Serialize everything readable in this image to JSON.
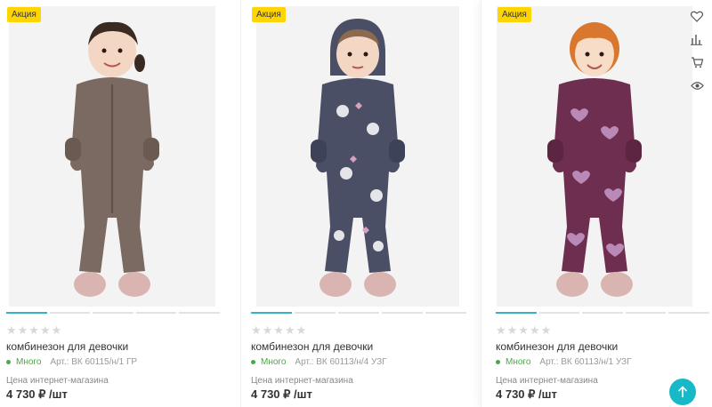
{
  "products": [
    {
      "badge": "Акция",
      "rating_stars": "★★★★★",
      "name": "комбинезон для девочки",
      "stock": "Много",
      "sku": "Арт.: ВК 60115/н/1 ГР",
      "price_label": "Цена интернет-магазина",
      "price": "4 730 ₽ /шт",
      "suit_color": "#7a6a61",
      "pattern": "dots"
    },
    {
      "badge": "Акция",
      "rating_stars": "★★★★★",
      "name": "комбинезон для девочки",
      "stock": "Много",
      "sku": "Арт.: ВК 60113/н/4 УЗГ",
      "price_label": "Цена интернет-магазина",
      "price": "4 730 ₽ /шт",
      "suit_color": "#4b4f66",
      "pattern": "unicorns"
    },
    {
      "badge": "Акция",
      "rating_stars": "★★★★★",
      "name": "комбинезон для девочки",
      "stock": "Много",
      "sku": "Арт.: ВК 60113/н/1 УЗГ",
      "price_label": "Цена интернет-магазина",
      "price": "4 730 ₽ /шт",
      "suit_color": "#6e2e4f",
      "pattern": "hearts"
    }
  ],
  "card_actions": [
    "heart-icon",
    "compare-icon",
    "basket-icon",
    "eye-icon"
  ],
  "colors": {
    "badge": "#ffd500",
    "accent": "#36b3c7",
    "stock": "#4aa845",
    "scroll_top": "#17b8c8"
  }
}
